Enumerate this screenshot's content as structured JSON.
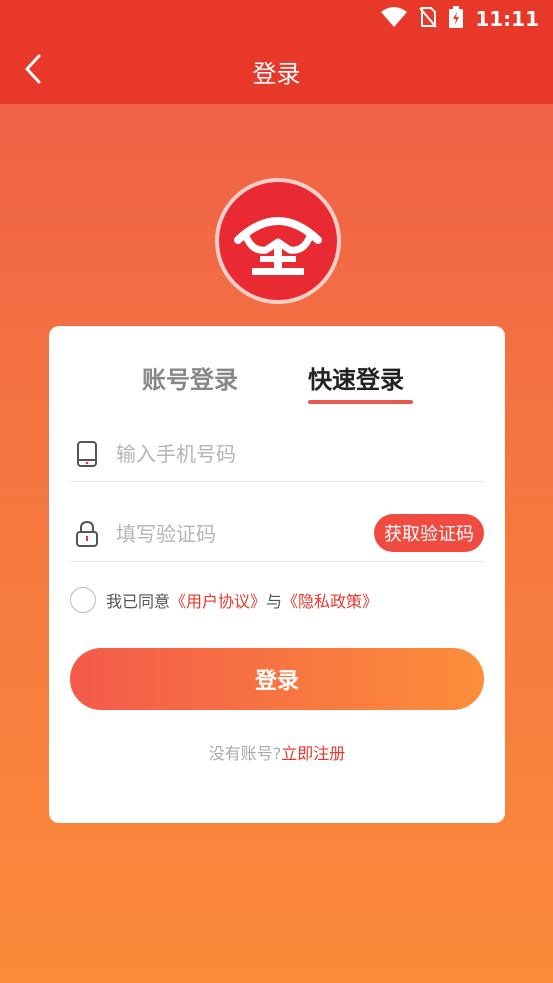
{
  "status_bar": {
    "time": "11:11"
  },
  "header": {
    "title": "登录"
  },
  "tabs": [
    {
      "label": "账号登录",
      "active": false
    },
    {
      "label": "快速登录",
      "active": true
    }
  ],
  "phone_field": {
    "placeholder": "输入手机号码",
    "value": ""
  },
  "code_field": {
    "placeholder": "填写验证码",
    "value": "",
    "get_code_label": "获取验证码"
  },
  "agreement": {
    "prefix": "我已同意",
    "user_agreement": "《用户协议》",
    "connector": "与",
    "privacy_policy": "《隐私政策》"
  },
  "login_button": {
    "label": "登录"
  },
  "register": {
    "prompt": "没有账号?",
    "link": "立即注册"
  },
  "colors": {
    "header": "#e8382a",
    "accent": "#ef4b40",
    "gradient_end": "#fb8a3a"
  }
}
